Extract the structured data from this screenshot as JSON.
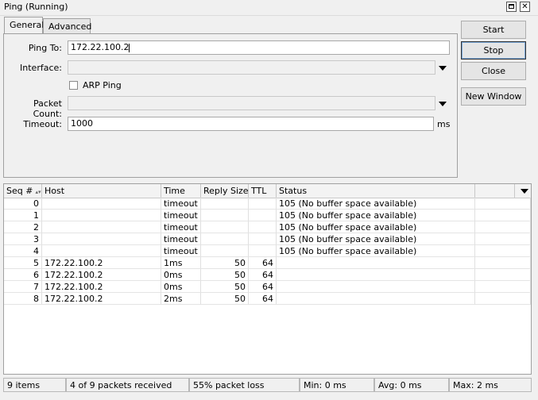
{
  "window": {
    "title": "Ping (Running)"
  },
  "tabs": [
    {
      "label": "General",
      "active": true
    },
    {
      "label": "Advanced",
      "active": false
    }
  ],
  "form": {
    "ping_to_label": "Ping To:",
    "ping_to_value": "172.22.100.2",
    "interface_label": "Interface:",
    "interface_value": "",
    "arp_ping_label": "ARP Ping",
    "arp_ping_checked": false,
    "packet_count_label": "Packet Count:",
    "packet_count_value": "",
    "timeout_label": "Timeout:",
    "timeout_value": "1000",
    "timeout_unit": "ms"
  },
  "buttons": {
    "start": "Start",
    "stop": "Stop",
    "close": "Close",
    "new_window": "New Window"
  },
  "table": {
    "columns": [
      "Seq #",
      "Host",
      "Time",
      "Reply Size",
      "TTL",
      "Status"
    ],
    "rows": [
      {
        "seq": "0",
        "host": "",
        "time": "timeout",
        "size": "",
        "ttl": "",
        "status": "105 (No buffer space available)"
      },
      {
        "seq": "1",
        "host": "",
        "time": "timeout",
        "size": "",
        "ttl": "",
        "status": "105 (No buffer space available)"
      },
      {
        "seq": "2",
        "host": "",
        "time": "timeout",
        "size": "",
        "ttl": "",
        "status": "105 (No buffer space available)"
      },
      {
        "seq": "3",
        "host": "",
        "time": "timeout",
        "size": "",
        "ttl": "",
        "status": "105 (No buffer space available)"
      },
      {
        "seq": "4",
        "host": "",
        "time": "timeout",
        "size": "",
        "ttl": "",
        "status": "105 (No buffer space available)"
      },
      {
        "seq": "5",
        "host": "172.22.100.2",
        "time": "1ms",
        "size": "50",
        "ttl": "64",
        "status": ""
      },
      {
        "seq": "6",
        "host": "172.22.100.2",
        "time": "0ms",
        "size": "50",
        "ttl": "64",
        "status": ""
      },
      {
        "seq": "7",
        "host": "172.22.100.2",
        "time": "0ms",
        "size": "50",
        "ttl": "64",
        "status": ""
      },
      {
        "seq": "8",
        "host": "172.22.100.2",
        "time": "2ms",
        "size": "50",
        "ttl": "64",
        "status": ""
      }
    ]
  },
  "status": {
    "items": "9 items",
    "received": "4 of 9 packets received",
    "loss": "55% packet loss",
    "min": "Min: 0 ms",
    "avg": "Avg: 0 ms",
    "max": "Max: 2 ms"
  },
  "colors": {
    "window_bg": "#f0f0f0",
    "field_border": "#a8a8a8",
    "focus": "#7aa7d8"
  }
}
